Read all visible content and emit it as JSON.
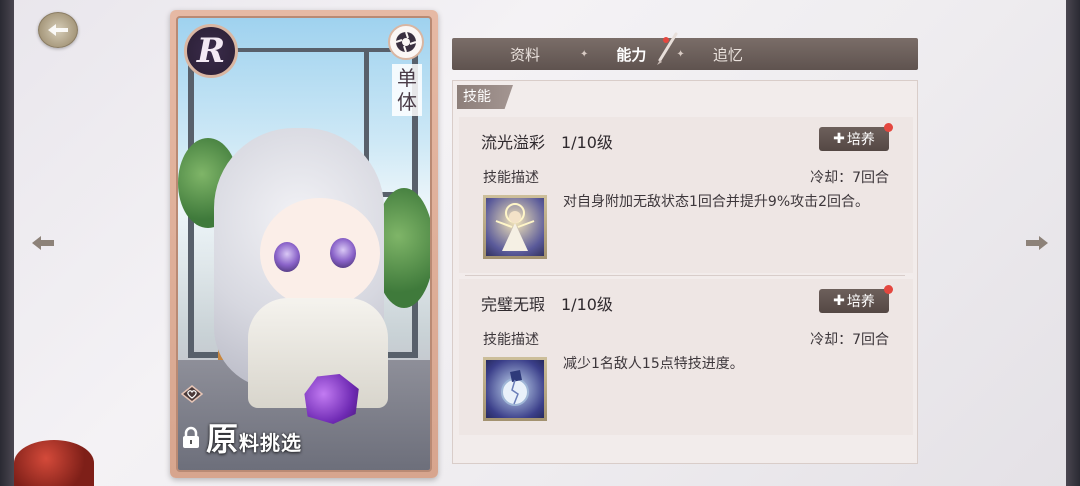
{
  "card": {
    "rarity": "R",
    "type_label": "单体",
    "name_big": "原",
    "name_rest": "料挑选"
  },
  "tabs": [
    {
      "label": "资料",
      "active": false
    },
    {
      "label": "能力",
      "active": true
    },
    {
      "label": "追忆",
      "active": false
    }
  ],
  "panel": {
    "tab_label": "技能"
  },
  "skills": [
    {
      "name": "流光溢彩",
      "level": "1/10级",
      "train_label": "培养",
      "desc_label": "技能描述",
      "cooldown": "冷却：7回合",
      "description": "对自身附加无敌状态1回合并提升9%攻击2回合。",
      "icon": "angel-figure-icon"
    },
    {
      "name": "完璧无瑕",
      "level": "1/10级",
      "train_label": "培养",
      "desc_label": "技能描述",
      "cooldown": "冷却：7回合",
      "description": "减少1名敌人15点特技进度。",
      "icon": "broken-crystal-icon"
    }
  ],
  "colors": {
    "accent": "#5f534f",
    "notify": "#e4473f",
    "card_frame": "#d7a58e"
  }
}
